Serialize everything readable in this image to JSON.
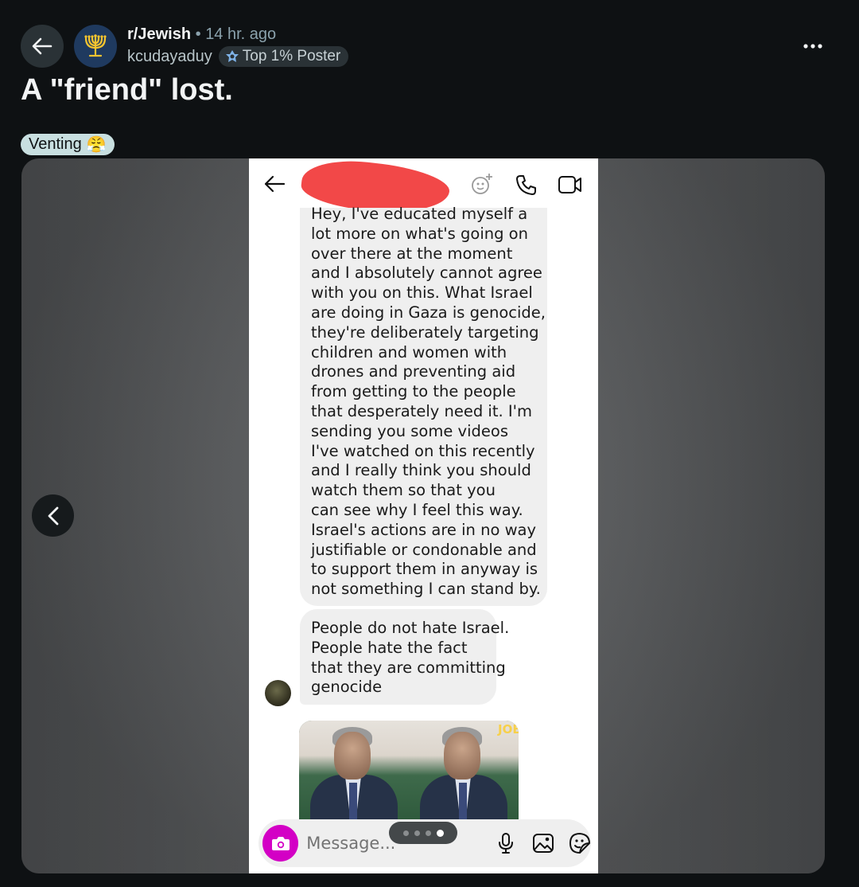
{
  "post": {
    "subreddit": "r/Jewish",
    "separator": "•",
    "age": "14 hr. ago",
    "username": "kcudayaduy",
    "user_flair": "Top 1% Poster",
    "title": "A \"friend\" lost.",
    "post_flair": "Venting",
    "post_flair_emoji": "😤"
  },
  "icons": {
    "back": "back-arrow-icon",
    "subreddit_avatar": "menorah-icon",
    "more": "more-options-icon",
    "prev": "chevron-left-icon"
  },
  "screenshot": {
    "chat_icons": [
      "back-arrow-icon",
      "effects-icon",
      "phone-icon",
      "video-call-icon"
    ],
    "message1_lines": [
      "Hey, I've educated myself a",
      "lot more on what's going on",
      "over there at the moment",
      "and I absolutely cannot agree",
      "with you on this. What Israel",
      "are doing in Gaza is genocide,",
      "they're deliberately targeting",
      "children and women with",
      "drones and preventing aid",
      "from getting to the people",
      "that desperately need it. I'm",
      "sending you some videos",
      "I've watched on this recently",
      "and I really think you should",
      "watch them so that you",
      "can see why I feel this way.",
      "Israel's actions are in no way",
      "justifiable or condonable and",
      "to support them in anyway is",
      "not something I can stand by."
    ],
    "message2_lines": [
      "People do not hate Israel.",
      "People hate the fact",
      "that they are committing",
      "genocide"
    ],
    "video_label": "JOE",
    "message_placeholder": "Message...",
    "carousel": {
      "count": 4,
      "active": 4
    }
  },
  "colors": {
    "background": "#0e1113",
    "redaction": "#f24848",
    "camera_button": "#d300c5",
    "post_flair_bg": "#c8dfe0"
  }
}
